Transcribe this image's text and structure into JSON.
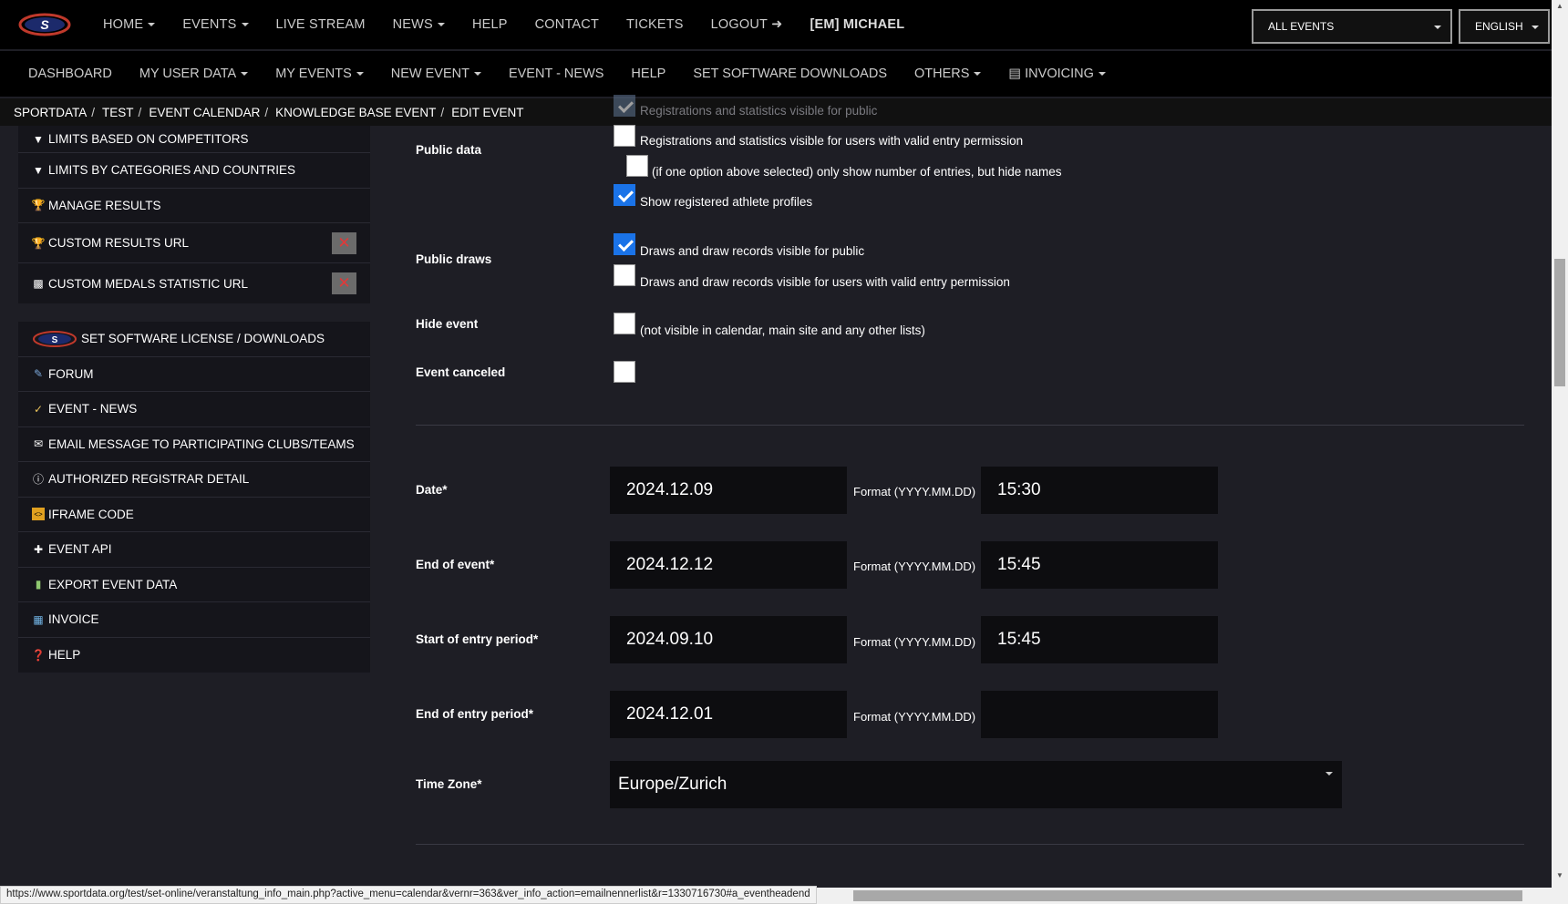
{
  "topnav": {
    "items": [
      {
        "label": "HOME",
        "caret": true
      },
      {
        "label": "EVENTS",
        "caret": true
      },
      {
        "label": "LIVE STREAM",
        "caret": false
      },
      {
        "label": "NEWS",
        "caret": true
      },
      {
        "label": "HELP",
        "caret": false
      },
      {
        "label": "CONTACT",
        "caret": false
      },
      {
        "label": "TICKETS",
        "caret": false
      },
      {
        "label": "LOGOUT",
        "caret": false
      },
      {
        "label": "[EM] MICHAEL",
        "caret": false
      }
    ],
    "events_select": "ALL EVENTS",
    "language_select": "ENGLISH"
  },
  "subnav": {
    "items": [
      "DASHBOARD",
      "MY USER DATA",
      "MY EVENTS",
      "NEW EVENT",
      "EVENT - NEWS",
      "HELP",
      "SET SOFTWARE DOWNLOADS",
      "OTHERS",
      "INVOICING"
    ]
  },
  "breadcrumb": [
    "SPORTDATA",
    "TEST",
    "EVENT CALENDAR",
    "KNOWLEDGE BASE EVENT",
    "EDIT EVENT"
  ],
  "sidebar": {
    "group1": [
      {
        "label": "LIMITS BASED ON COMPETITORS",
        "icon": "filter-icon"
      },
      {
        "label": "LIMITS BY CATEGORIES AND COUNTRIES",
        "icon": "filter-icon"
      },
      {
        "label": "MANAGE RESULTS",
        "icon": "trophy-icon"
      },
      {
        "label": "CUSTOM RESULTS URL",
        "icon": "trophy-icon",
        "remove": "✕"
      },
      {
        "label": "CUSTOM MEDALS STATISTIC URL",
        "icon": "bar-chart-icon",
        "remove": "✕"
      }
    ],
    "group2": [
      {
        "label": "SET SOFTWARE LICENSE / DOWNLOADS",
        "icon": "set-logo-icon"
      },
      {
        "label": "FORUM",
        "icon": "forum-icon"
      },
      {
        "label": "EVENT - NEWS",
        "icon": "news-icon"
      },
      {
        "label": "EMAIL MESSAGE TO PARTICIPATING CLUBS/TEAMS",
        "icon": "envelope-icon"
      },
      {
        "label": "AUTHORIZED REGISTRAR DETAIL",
        "icon": "info-icon"
      },
      {
        "label": "IFRAME CODE",
        "icon": "code-icon"
      },
      {
        "label": "EVENT API",
        "icon": "puzzle-icon"
      },
      {
        "label": "EXPORT EVENT DATA",
        "icon": "export-icon"
      },
      {
        "label": "INVOICE",
        "icon": "invoice-icon"
      },
      {
        "label": "HELP",
        "icon": "help-icon"
      }
    ]
  },
  "form": {
    "public_data": {
      "label": "Public data",
      "opt_public": "Registrations and statistics visible for public",
      "opt_valid": "Registrations and statistics visible for users with valid entry permission",
      "opt_hide_names": "(if one option above selected) only show number of entries, but hide names",
      "opt_profiles": "Show registered athlete profiles"
    },
    "public_draws": {
      "label": "Public draws",
      "opt_public": "Draws and draw records visible for public",
      "opt_valid": "Draws and draw records visible for users with valid entry permission"
    },
    "hide_event": {
      "label": "Hide event",
      "text": "(not visible in calendar, main site and any other lists)"
    },
    "event_canceled": {
      "label": "Event canceled"
    },
    "date": {
      "label": "Date*",
      "value": "2024.12.09",
      "format": "Format (YYYY.MM.DD)",
      "time": "15:30"
    },
    "end_of_event": {
      "label": "End of event*",
      "value": "2024.12.12",
      "format": "Format (YYYY.MM.DD)",
      "time": "15:45"
    },
    "start_entry": {
      "label": "Start of entry period*",
      "value": "2024.09.10",
      "format": "Format (YYYY.MM.DD)",
      "time": "15:45"
    },
    "end_entry": {
      "label": "End of entry period*",
      "value": "2024.12.01",
      "format": "Format (YYYY.MM.DD)",
      "time": ""
    },
    "time_zone": {
      "label": "Time Zone*",
      "value": "Europe/Zurich"
    }
  },
  "status_url": "https://www.sportdata.org/test/set-online/veranstaltung_info_main.php?active_menu=calendar&vernr=363&ver_info_action=emailnennerlist&r=1330716730#a_eventheadend"
}
